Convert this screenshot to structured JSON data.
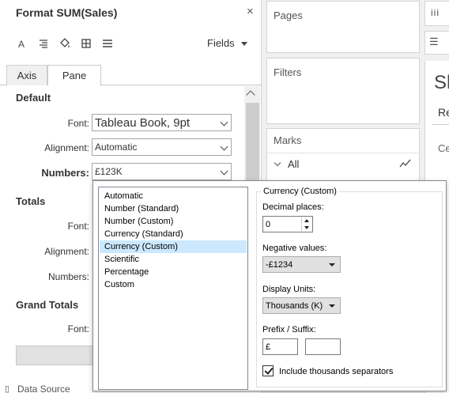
{
  "format_pane": {
    "title": "Format SUM(Sales)",
    "close_glyph": "×",
    "toolbar_icons": [
      "font-icon",
      "alignment-icon",
      "shading-icon",
      "borders-icon",
      "lines-icon"
    ],
    "fields_label": "Fields",
    "tabs": [
      {
        "label": "Axis",
        "active": false
      },
      {
        "label": "Pane",
        "active": true
      }
    ],
    "default": {
      "heading": "Default",
      "font_label": "Font:",
      "font_value": "Tableau Book, 9pt",
      "alignment_label": "Alignment:",
      "alignment_value": "Automatic",
      "numbers_label": "Numbers:",
      "numbers_value": "£123K"
    },
    "totals": {
      "heading": "Totals",
      "font_label": "Font:",
      "alignment_label": "Alignment:",
      "numbers_label": "Numbers:"
    },
    "grand_totals": {
      "heading": "Grand Totals",
      "font_label": "Font:"
    },
    "status": "Data Source"
  },
  "shelves": {
    "pages": "Pages",
    "filters": "Filters",
    "marks": "Marks",
    "marks_type": "All"
  },
  "right_column": {
    "columns_glyph": "iii",
    "rows_glyph": "☰",
    "sheet_partial": "Sh",
    "re_partial": "Re",
    "ce_partial": "Ce"
  },
  "number_popup": {
    "formats": [
      "Automatic",
      "Number (Standard)",
      "Number (Custom)",
      "Currency (Standard)",
      "Currency (Custom)",
      "Scientific",
      "Percentage",
      "Custom"
    ],
    "selected_index": 4,
    "group_title": "Currency (Custom)",
    "decimal_label": "Decimal places:",
    "decimal_value": "0",
    "negative_label": "Negative values:",
    "negative_value": "-£1234",
    "units_label": "Display Units:",
    "units_value": "Thousands (K)",
    "prefix_label": "Prefix / Suffix:",
    "prefix_value": "£",
    "suffix_value": "",
    "thousands_label": "Include thousands separators",
    "thousands_checked": true
  },
  "colors": {
    "selection": "#cce8ff",
    "panel_bg": "#ffffff",
    "app_bg": "#f0f0f0"
  }
}
